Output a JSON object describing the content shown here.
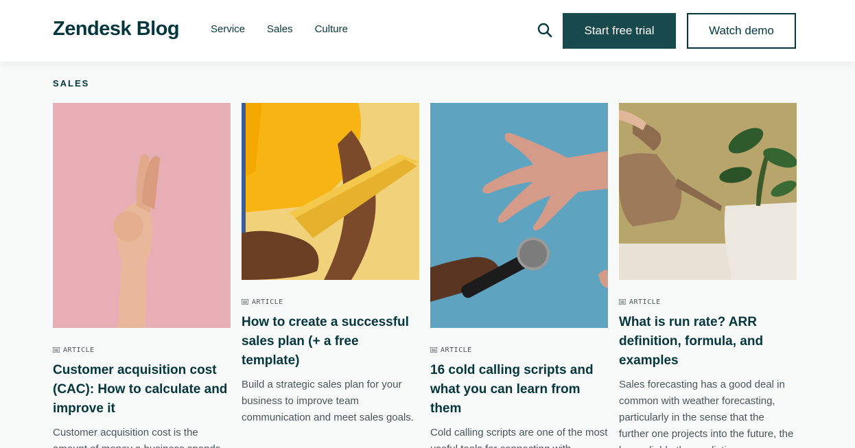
{
  "header": {
    "logo": "Zendesk Blog",
    "nav": [
      "Service",
      "Sales",
      "Culture"
    ],
    "cta_primary": "Start free trial",
    "cta_secondary": "Watch demo"
  },
  "section": {
    "label": "SALES"
  },
  "cards": [
    {
      "image": "crossed-fingers-image",
      "type": "ARTICLE",
      "title": "Customer acquisition cost (CAC): How to calculate and improve it",
      "excerpt": "Customer acquisition cost is the amount of money a business spends"
    },
    {
      "image": "clipboard-image",
      "type": "ARTICLE",
      "title": "How to create a successful sales plan (+ a free template)",
      "excerpt": "Build a strategic sales plan for your business to improve team communication and meet sales goals."
    },
    {
      "image": "microphone-image",
      "type": "ARTICLE",
      "title": "16 cold calling scripts and what you can learn from them",
      "excerpt": "Cold calling scripts are one of the most useful tools for connecting with"
    },
    {
      "image": "watering-can-plant-image",
      "type": "ARTICLE",
      "title": "What is run rate? ARR definition, formula, and examples",
      "excerpt": "Sales forecasting has a good deal in common with weather forecasting, particularly in the sense that the further one projects into the future, the less reliable the predictions"
    }
  ],
  "colors": {
    "brand": "#03363d",
    "button_primary": "#17494d",
    "card1_bg": "#e7aeb6",
    "card2_bg": "#f1c63f",
    "card3_bg": "#5ea4c0",
    "card4_bg": "#b7a56c"
  }
}
